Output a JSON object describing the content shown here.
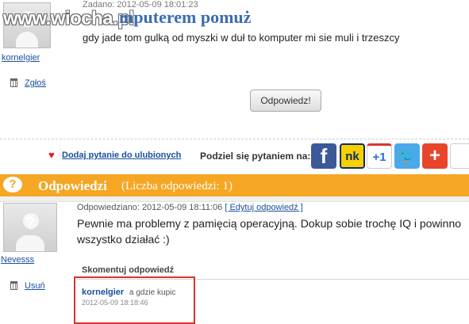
{
  "watermark": "www.wiocha.pl",
  "question": {
    "meta": "Zadano: 2012-05-09 18:01:23",
    "title_fragment": "mputerem pomuż",
    "body": "gdy jade tom gulką od myszki w duł to komputer mi sie muli i trzeszcy",
    "author": "kornelgier",
    "report_label": "Zgłoś",
    "answer_button": "Odpowiedz!"
  },
  "share_bar": {
    "favorite_label": "Dodaj pytanie do ulubionych",
    "share_label": "Podziel się pytaniem na:",
    "services": [
      "f",
      "nk",
      "+1",
      "twitter",
      "+",
      ""
    ]
  },
  "answers": {
    "title": "Odpowiedzi",
    "count_text": "(Liczba odpowiedzi: 1)",
    "items": [
      {
        "author": "Nevesss",
        "meta": "Odpowiedziano: 2012-05-09 18:11:06",
        "edit_link": "[ Edytuj odpowiedź ]",
        "text": "Pewnie ma problemy z pamięcią operacyjną. Dokup sobie trochę IQ i powinno wszystko działać :)",
        "delete_label": "Usuń",
        "comment_header": "Skomentuj odpowiedź",
        "comment": {
          "author": "kornelgier",
          "text": "a gdzie kupic",
          "date": "2012-05-09 18:18:46"
        }
      }
    ]
  },
  "colors": {
    "accent": "#f5a623",
    "link": "#1a4f9c",
    "highlight_box": "#d9342b"
  }
}
